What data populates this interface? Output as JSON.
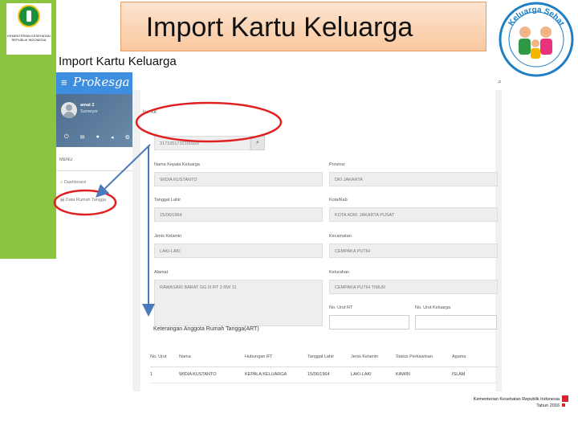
{
  "slide": {
    "title": "Import Kartu Keluarga",
    "subtitle": "Import Kartu Keluarga",
    "logo_left_text": "KEMENTERIAN KESEHATAN REPUBLIK INDONESIA",
    "logo_right_text": "Keluarga Sehat",
    "footer_line1": "Kementerian Kesehatan Republik Indonesia",
    "footer_line2": "Tahun 2016"
  },
  "app": {
    "brand": "Prokesga",
    "menu_icon": "hamburger-icon",
    "user_name": "amat 2",
    "user_role": "Surveyor",
    "menu_heading": "MENU",
    "menu_items": [
      "Dashboard",
      "Data Rumah Tangga"
    ],
    "topbar_icons": [
      "search-icon",
      "globe-icon"
    ]
  },
  "form": {
    "no_kk_label": "No. KK",
    "no_kk_value": "3171051710100320",
    "kepala_label": "Nama Kepala Keluarga",
    "kepala_value": "WIDIA KUSTANTO",
    "tgl_label": "Tanggal Lahir",
    "tgl_value": "15/06/1964",
    "jk_label": "Jenis Kelamin",
    "jk_value": "LAKI-LAKI",
    "alamat_label": "Alamat",
    "alamat_value": "RAWASARI BARAT GG III RT 3 RW 11",
    "provinsi_label": "Provinsi",
    "provinsi_value": "DKI JAKARTA",
    "kota_label": "Kota/Kab",
    "kota_value": "KOTA ADM. JAKARTA PUSAT",
    "kec_label": "Kecamatan",
    "kec_value": "CEMPAKA PUTIH",
    "kel_label": "Kelurahan",
    "kel_value": "CEMPAKA PUTIH TIMUR",
    "rt_label": "No. Urut RT",
    "rt_value": "",
    "keluarga_label": "No. Urut Keluarga",
    "keluarga_value": ""
  },
  "members": {
    "title": "Keterangan Anggota Rumah Tangga(ART)",
    "columns": [
      "No. Urut",
      "Nama",
      "Hubungan RT",
      "Tanggal Lahir",
      "Jenis Kelamin",
      "Status Perkawinan",
      "Agama"
    ],
    "rows": [
      [
        "1",
        "WIDIA KUSTANTO",
        "KEPALA KELUARGA",
        "15/06/1964",
        "LAKI-LAKI",
        "KAWIN",
        "ISLAM"
      ]
    ]
  },
  "colors": {
    "band": "#8bc53f",
    "sidebar_header": "#3d8ede",
    "highlight": "#e02020",
    "arrow": "#4a7ab8"
  }
}
